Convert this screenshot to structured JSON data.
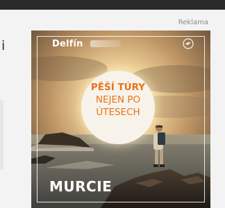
{
  "page": {
    "ad_label": "Reklama",
    "left_partial_text": "i"
  },
  "ad": {
    "brand": "Delfín",
    "headline": {
      "line1": "PĚŠÍ TÚRY",
      "line2": "NEJEN PO",
      "line3": "ÚTESECH"
    },
    "destination": "MURCIE",
    "logo_icon": "dolphin-logo-icon",
    "colors": {
      "headline_text": "#e8731a",
      "headline_disc": "#f7f3ea",
      "page_bg": "#f3f3f3",
      "top_bar": "#2b2b2b"
    }
  }
}
